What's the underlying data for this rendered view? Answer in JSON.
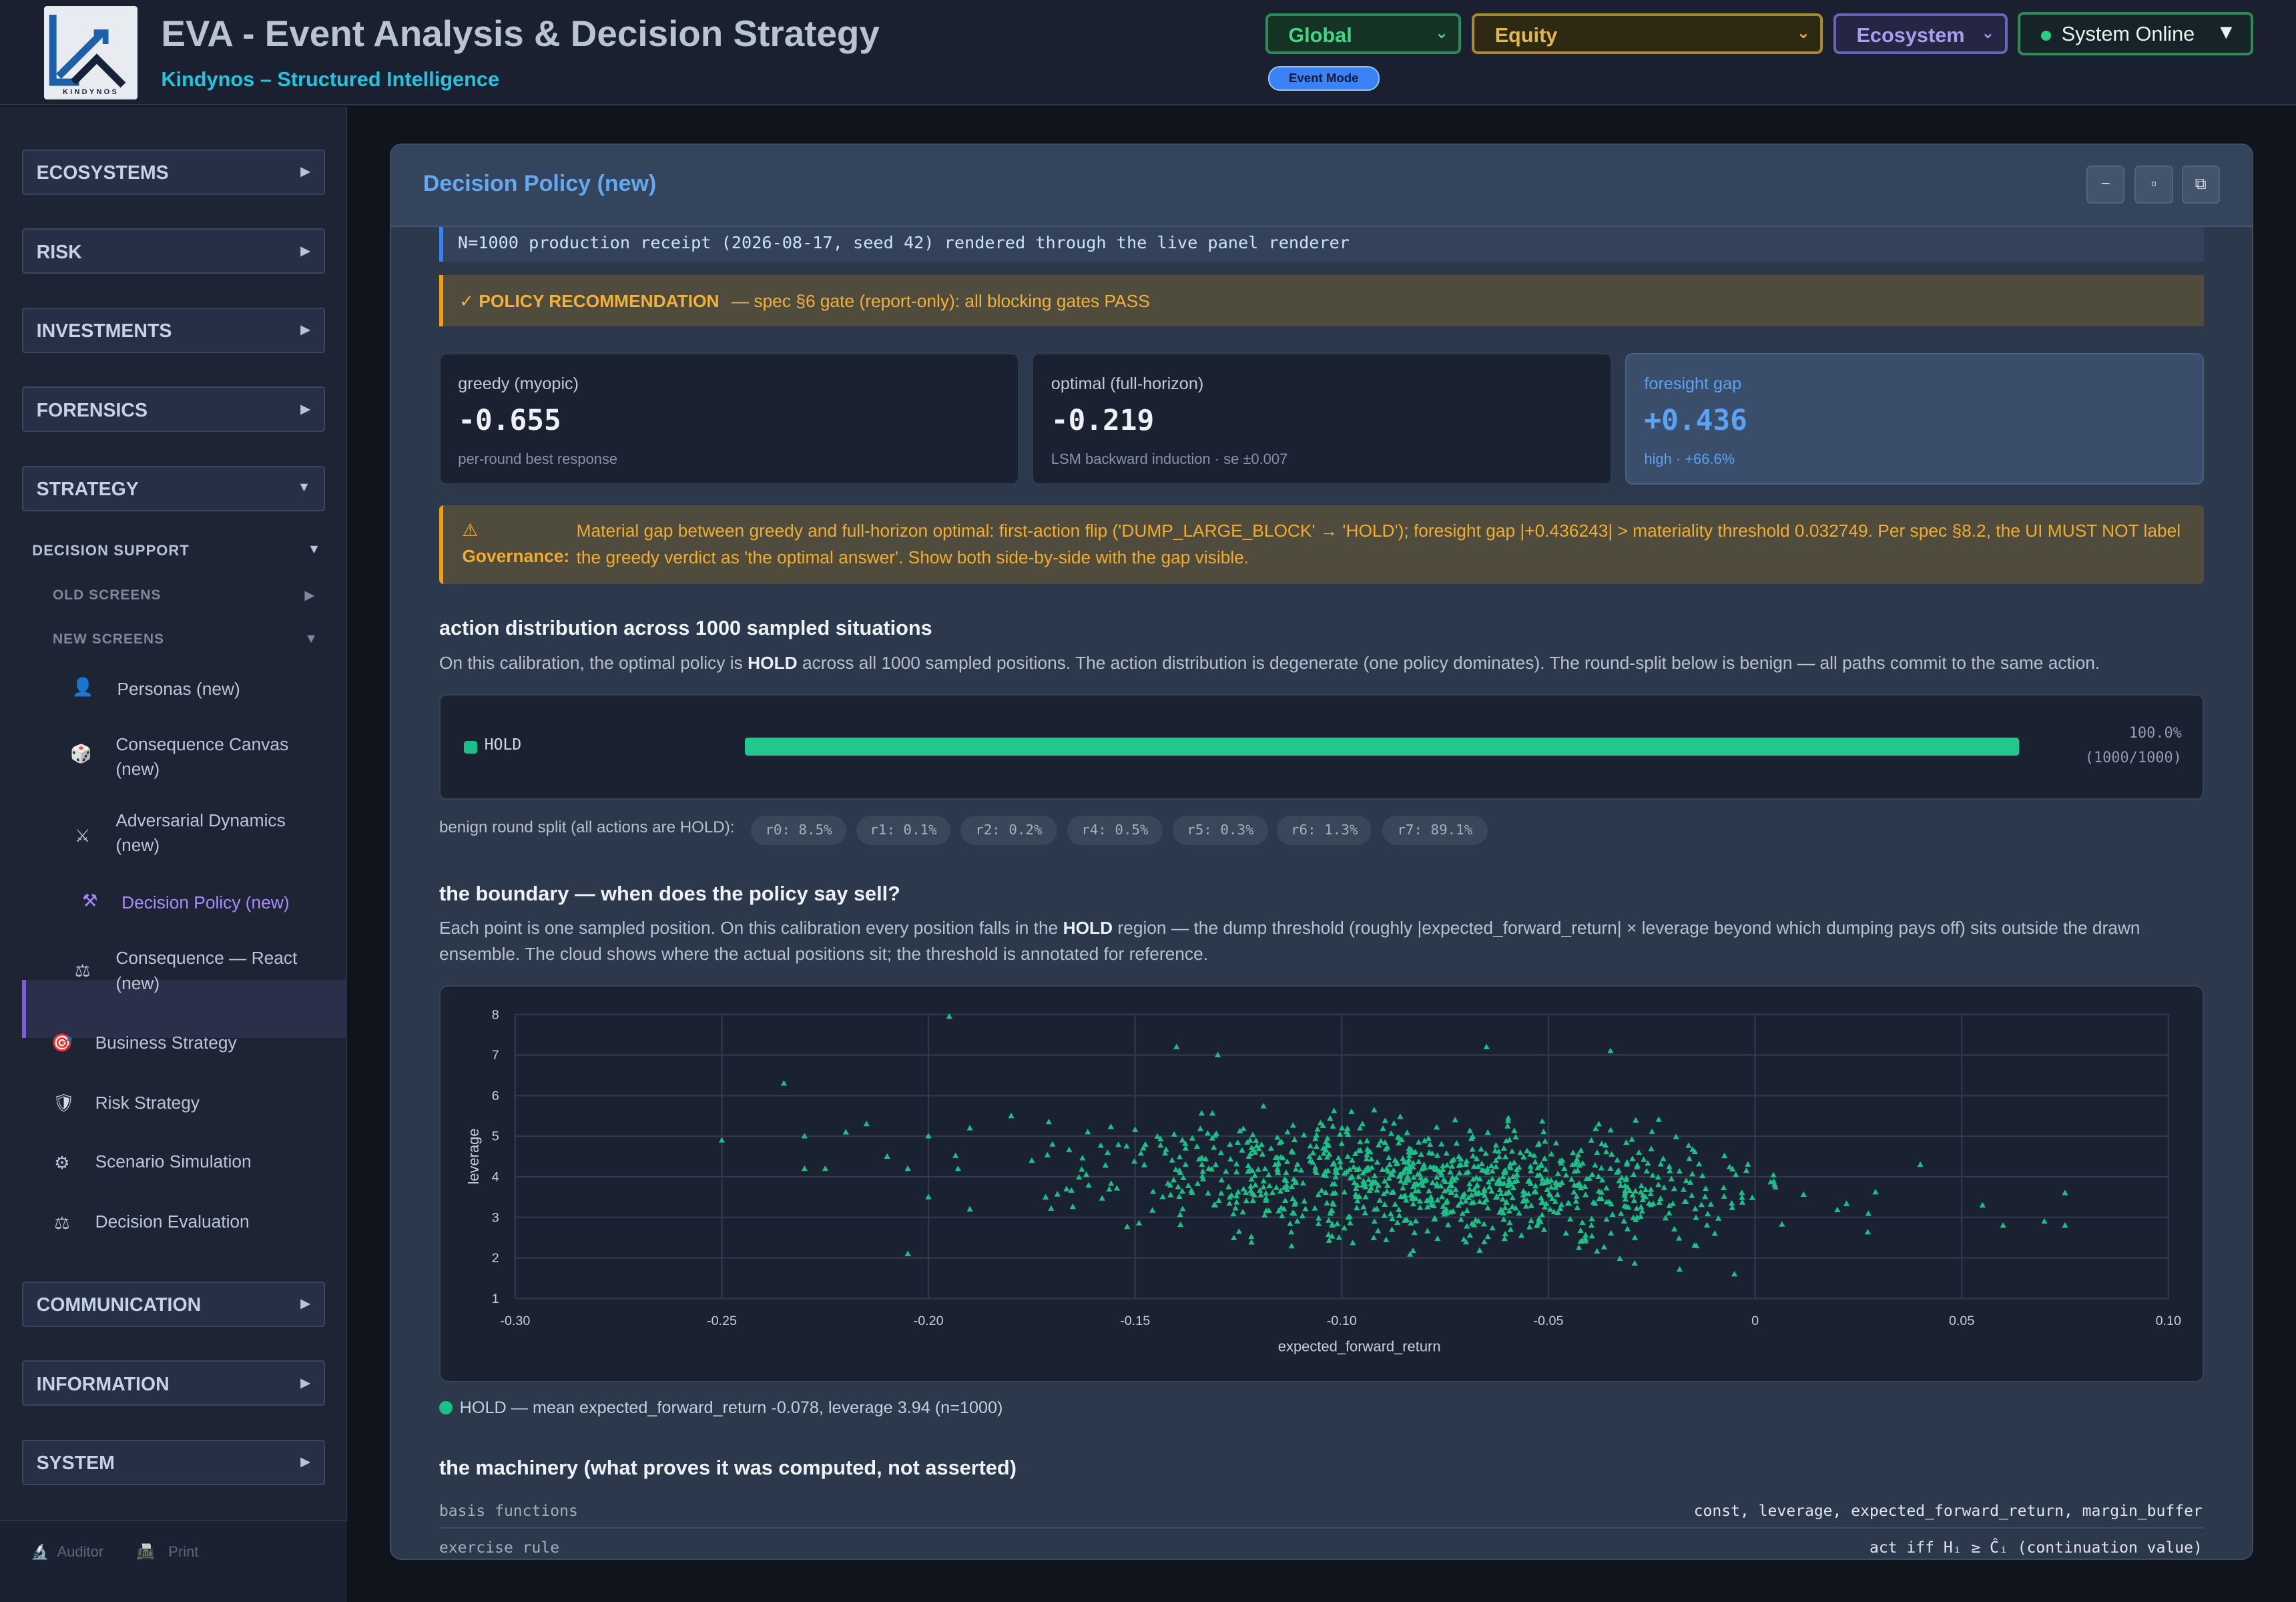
{
  "header": {
    "title": "EVA - Event Analysis & Decision Strategy",
    "subtitle": "Kindynos – Structured Intelligence",
    "logo_text": "KINDYNOS",
    "selects": {
      "region": "Global",
      "asset": "Equity",
      "view": "Ecosystem"
    },
    "status": "System Online",
    "event_mode": "Event Mode"
  },
  "sidebar": {
    "sections": {
      "ecosystems": "ECOSYSTEMS",
      "risk": "RISK",
      "investments": "INVESTMENTS",
      "forensics": "FORENSICS",
      "strategy": "STRATEGY",
      "communication": "COMMUNICATION",
      "information": "INFORMATION",
      "system": "SYSTEM"
    },
    "decision_support": "DECISION SUPPORT",
    "old_screens": "OLD SCREENS",
    "new_screens": "NEW SCREENS",
    "new_items": [
      "Personas (new)",
      "Consequence Canvas (new)",
      "Adversarial Dynamics (new)",
      "Decision Policy (new)",
      "Consequence — React (new)"
    ],
    "strategy_items": [
      "Business Strategy",
      "Risk Strategy",
      "Scenario Simulation",
      "Decision Evaluation"
    ],
    "footer": {
      "auditor": "Auditor",
      "print": "Print"
    },
    "icons": [
      "person-icon",
      "dice-icon",
      "crossed-swords-icon",
      "hammer-pick-icon",
      "scales-icon",
      "target-icon",
      "shield-icon",
      "gear-icon",
      "scales-icon"
    ]
  },
  "panel": {
    "title": "Decision Policy (new)",
    "buttons": {
      "minimize": "−",
      "maximize": "▫",
      "popout": "⧉"
    },
    "receipt": "N=1000 production receipt (2026-08-17, seed 42) rendered through the live panel renderer",
    "recommendation": {
      "label": "✓ POLICY RECOMMENDATION",
      "text": "— spec §6 gate (report-only): all blocking gates PASS"
    },
    "metrics": [
      {
        "label": "greedy (myopic)",
        "value": "-0.655",
        "sub": "per-round best response"
      },
      {
        "label": "optimal (full-horizon)",
        "value": "-0.219",
        "sub": "LSM backward induction · se ±0.007"
      },
      {
        "label": "foresight gap",
        "value": "+0.436",
        "sub": "high · +66.6%"
      }
    ],
    "governance": {
      "icon": "⚠",
      "label": "Governance:",
      "text": "Material gap between greedy and full-horizon optimal: first-action flip ('DUMP_LARGE_BLOCK' → 'HOLD'); foresight gap |+0.436243| > materiality threshold 0.032749. Per spec §8.2, the UI MUST NOT label the greedy verdict as 'the optimal answer'. Show both side-by-side with the gap visible."
    },
    "distribution": {
      "heading": "action distribution across 1000 sampled situations",
      "para_pre": "On this calibration, the optimal policy is ",
      "para_bold": "HOLD",
      "para_post": " across all 1000 sampled positions. The action distribution is degenerate (one policy dominates). The round-split below is benign — all paths commit to the same action.",
      "action": "HOLD",
      "share": 1.0,
      "pct_text": "100.0%",
      "count_text": "(1000/1000)",
      "split_label": "benign round split (all actions are HOLD):",
      "splits": [
        "r0: 8.5%",
        "r1: 0.1%",
        "r2: 0.2%",
        "r4: 0.5%",
        "r5: 0.3%",
        "r6: 1.3%",
        "r7: 89.1%"
      ]
    },
    "boundary": {
      "heading": "the boundary — when does the policy say sell?",
      "para_pre": "Each point is one sampled position. On this calibration every position falls in the ",
      "para_bold": "HOLD",
      "para_post": " region — the dump threshold (roughly |expected_forward_return| × leverage beyond which dumping pays off) sits outside the drawn ensemble. The cloud shows where the actual positions sit; the threshold is annotated for reference.",
      "legend": "HOLD — mean expected_forward_return -0.078, leverage 3.94 (n=1000)"
    },
    "machinery": {
      "heading": "the machinery (what proves it was computed, not asserted)",
      "rows": [
        {
          "key": "basis functions",
          "value": "const, leverage, expected_forward_return, margin_buffer"
        },
        {
          "key": "exercise rule",
          "value": "act iff Hᵢ ≥ Ĉᵢ (continuation value)"
        }
      ]
    }
  },
  "chart_data": {
    "type": "scatter",
    "xlabel": "expected_forward_return",
    "ylabel": "leverage",
    "xlim": [
      -0.3,
      0.1
    ],
    "ylim": [
      1,
      8
    ],
    "x_ticks": [
      "-0.30",
      "-0.25",
      "-0.20",
      "-0.15",
      "-0.10",
      "-0.05",
      "0",
      "0.05",
      "0.10"
    ],
    "y_ticks": [
      "1",
      "2",
      "3",
      "4",
      "5",
      "6",
      "7",
      "8"
    ],
    "grid": true,
    "marker": "triangle",
    "color": "#1bbf87",
    "series": [
      {
        "name": "HOLD",
        "n": 1000,
        "mean_x": -0.078,
        "mean_y": 3.94,
        "sample_points": [
          [
            -0.25,
            4.9
          ],
          [
            -0.235,
            6.3
          ],
          [
            -0.23,
            4.2
          ],
          [
            -0.225,
            4.2
          ],
          [
            -0.23,
            5.0
          ],
          [
            -0.22,
            5.1
          ],
          [
            -0.215,
            5.3
          ],
          [
            -0.21,
            4.5
          ],
          [
            -0.205,
            4.2
          ],
          [
            -0.2,
            5.0
          ],
          [
            -0.205,
            2.1
          ],
          [
            -0.195,
            7.95
          ],
          [
            -0.19,
            5.2
          ],
          [
            -0.18,
            5.5
          ],
          [
            -0.175,
            4.4
          ],
          [
            -0.17,
            4.8
          ],
          [
            -0.14,
            7.2
          ],
          [
            -0.13,
            7.0
          ],
          [
            -0.095,
            5.3
          ],
          [
            -0.065,
            7.2
          ],
          [
            -0.035,
            7.1
          ],
          [
            0.04,
            4.3
          ],
          [
            0.055,
            3.3
          ],
          [
            0.06,
            2.8
          ],
          [
            0.07,
            2.9
          ],
          [
            0.075,
            3.6
          ],
          [
            0.075,
            2.8
          ],
          [
            -0.005,
            1.6
          ],
          [
            -0.2,
            3.5
          ],
          [
            -0.19,
            3.2
          ]
        ]
      }
    ]
  }
}
